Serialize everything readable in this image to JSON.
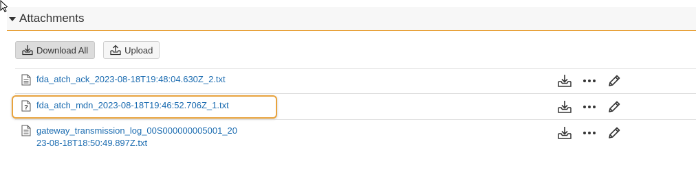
{
  "section": {
    "title": "Attachments"
  },
  "toolbar": {
    "download_all_label": "Download All",
    "upload_label": "Upload"
  },
  "files": [
    {
      "name": "fda_atch_ack_2023-08-18T19:48:04.630Z_2.txt",
      "icon": "text-file-icon"
    },
    {
      "name": "fda_atch_mdn_2023-08-18T19:46:52.706Z_1.txt",
      "icon": "unknown-file-icon",
      "highlighted": true
    },
    {
      "name_line1": "gateway_transmission_log_00S000000005001_20",
      "name_line2": "23-08-18T18:50:49.897Z.txt",
      "icon": "text-file-icon"
    }
  ],
  "row_actions": [
    "download-icon",
    "more-options-icon",
    "edit-pencil-icon"
  ],
  "colors": {
    "accent": "#e8a33d",
    "link": "#1a6bb0",
    "header_bg": "#f7f7f7"
  }
}
